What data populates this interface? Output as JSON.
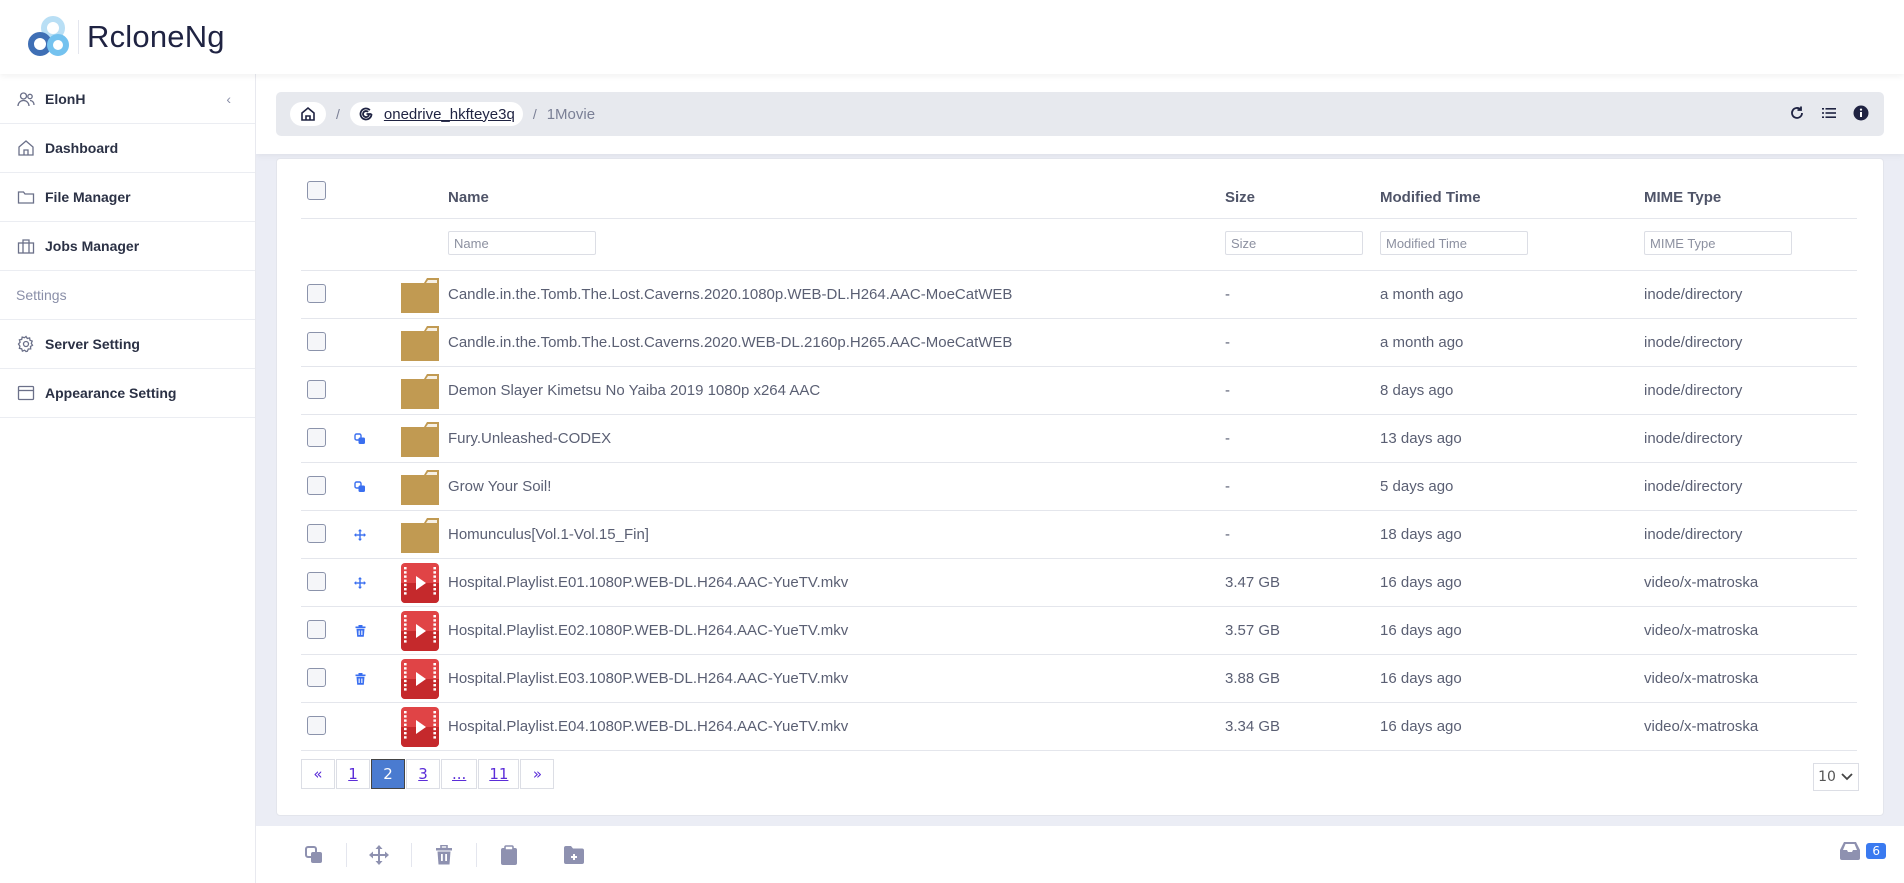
{
  "app": {
    "title": "RcloneNg",
    "brand_colors": {
      "logo_dark": "#3f6fb5",
      "logo_light": "#74c2ef",
      "accent": "#3a7af0",
      "folder": "#c19a52",
      "video": "#d6383a"
    }
  },
  "sidebar": {
    "user": {
      "label": "ElonH",
      "icon": "people-icon",
      "collapse_icon": "chevron-left-icon"
    },
    "items": [
      {
        "label": "Dashboard",
        "icon": "home-icon"
      },
      {
        "label": "File Manager",
        "icon": "folder-icon"
      },
      {
        "label": "Jobs Manager",
        "icon": "briefcase-icon"
      }
    ],
    "section_title": "Settings",
    "settings_items": [
      {
        "label": "Server Setting",
        "icon": "gear-icon"
      },
      {
        "label": "Appearance Setting",
        "icon": "browser-window-icon"
      }
    ]
  },
  "breadcrumb": {
    "home_icon": "home-icon",
    "separator": "/",
    "remote": "onedrive_hkfteye3q",
    "remote_icon": "google-g-icon",
    "current": "1Movie",
    "actions": [
      "refresh-icon",
      "list-icon",
      "info-icon"
    ]
  },
  "table": {
    "headers": {
      "name": "Name",
      "size": "Size",
      "modified": "Modified Time",
      "mime": "MIME Type"
    },
    "filters": {
      "name": "Name",
      "size": "Size",
      "modified": "Modified Time",
      "mime": "MIME Type"
    },
    "rows": [
      {
        "name": "Candle.in.the.Tomb.The.Lost.Caverns.2020.1080p.WEB-DL.H264.AAC-MoeCatWEB",
        "size": "-",
        "modified": "a month ago",
        "mime": "inode/directory",
        "type": "folder",
        "job": ""
      },
      {
        "name": "Candle.in.the.Tomb.The.Lost.Caverns.2020.WEB-DL.2160p.H265.AAC-MoeCatWEB",
        "size": "-",
        "modified": "a month ago",
        "mime": "inode/directory",
        "type": "folder",
        "job": ""
      },
      {
        "name": "Demon Slayer Kimetsu No Yaiba 2019 1080p x264 AAC",
        "size": "-",
        "modified": "8 days ago",
        "mime": "inode/directory",
        "type": "folder",
        "job": ""
      },
      {
        "name": "Fury.Unleashed-CODEX",
        "size": "-",
        "modified": "13 days ago",
        "mime": "inode/directory",
        "type": "folder",
        "job": "copy"
      },
      {
        "name": "Grow Your Soil!",
        "size": "-",
        "modified": "5 days ago",
        "mime": "inode/directory",
        "type": "folder",
        "job": "copy"
      },
      {
        "name": "Homunculus[Vol.1-Vol.15_Fin]",
        "size": "-",
        "modified": "18 days ago",
        "mime": "inode/directory",
        "type": "folder",
        "job": "move"
      },
      {
        "name": "Hospital.Playlist.E01.1080P.WEB-DL.H264.AAC-YueTV.mkv",
        "size": "3.47 GB",
        "modified": "16 days ago",
        "mime": "video/x-matroska",
        "type": "video",
        "job": "move"
      },
      {
        "name": "Hospital.Playlist.E02.1080P.WEB-DL.H264.AAC-YueTV.mkv",
        "size": "3.57 GB",
        "modified": "16 days ago",
        "mime": "video/x-matroska",
        "type": "video",
        "job": "delete"
      },
      {
        "name": "Hospital.Playlist.E03.1080P.WEB-DL.H264.AAC-YueTV.mkv",
        "size": "3.88 GB",
        "modified": "16 days ago",
        "mime": "video/x-matroska",
        "type": "video",
        "job": "delete"
      },
      {
        "name": "Hospital.Playlist.E04.1080P.WEB-DL.H264.AAC-YueTV.mkv",
        "size": "3.34 GB",
        "modified": "16 days ago",
        "mime": "video/x-matroska",
        "type": "video",
        "job": ""
      }
    ]
  },
  "pagination": {
    "prev": "«",
    "pages": [
      "1",
      "2",
      "3",
      "...",
      "11"
    ],
    "current": "2",
    "next": "»",
    "page_size": "10"
  },
  "bottombar": {
    "actions": [
      "copy-icon",
      "move-icon",
      "trash-icon",
      "clipboard-icon",
      "folder-plus-icon"
    ],
    "clipboard_icon": "inbox-icon",
    "clipboard_count": "6"
  }
}
